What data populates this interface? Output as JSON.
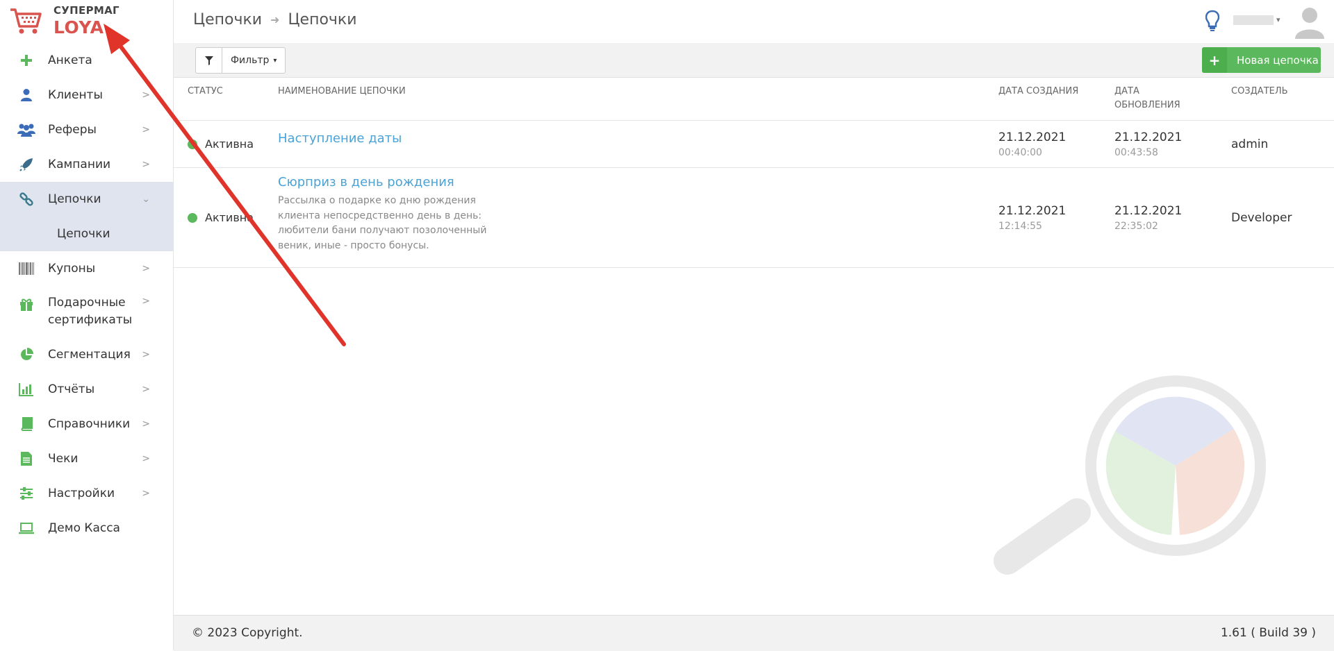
{
  "logo": {
    "line1": "СУПЕРМАГ",
    "line2": "LOYA"
  },
  "sidebar": {
    "items": [
      {
        "label": "Анкета",
        "icon": "plus-icon"
      },
      {
        "label": "Клиенты",
        "icon": "user-icon",
        "chevron": ">"
      },
      {
        "label": "Реферы",
        "icon": "users-icon",
        "chevron": ">"
      },
      {
        "label": "Кампании",
        "icon": "rocket-icon",
        "chevron": ">"
      },
      {
        "label": "Цепочки",
        "icon": "link-icon",
        "chevron": "⌄"
      },
      {
        "label": "Цепочки"
      },
      {
        "label": "Купоны",
        "icon": "barcode-icon",
        "chevron": ">"
      },
      {
        "label_line1": "Подарочные",
        "label_line2": "сертификаты",
        "icon": "gift-icon",
        "chevron": ">"
      },
      {
        "label": "Сегментация",
        "icon": "pie-chart-icon",
        "chevron": ">"
      },
      {
        "label": "Отчёты",
        "icon": "bar-chart-icon",
        "chevron": ">"
      },
      {
        "label": "Справочники",
        "icon": "book-icon",
        "chevron": ">"
      },
      {
        "label": "Чеки",
        "icon": "receipt-icon",
        "chevron": ">"
      },
      {
        "label": "Настройки",
        "icon": "sliders-icon",
        "chevron": ">"
      },
      {
        "label": "Демо Касса",
        "icon": "laptop-icon"
      }
    ]
  },
  "header": {
    "breadcrumb": [
      "Цепочки",
      "Цепочки"
    ],
    "breadcrumb_sep": "➜",
    "user_caret": "▾"
  },
  "toolbar": {
    "filter_label": "Фильтр",
    "filter_caret": "▾",
    "new_label": "Новая цепочка",
    "new_plus": "+"
  },
  "table": {
    "headers": {
      "status": "СТАТУС",
      "name": "НАИМЕНОВАНИЕ ЦЕПОЧКИ",
      "created": "ДАТА СОЗДАНИЯ",
      "updated_1": "ДАТА",
      "updated_2": "ОБНОВЛЕНИЯ",
      "creator": "СОЗДАТЕЛЬ"
    },
    "rows": [
      {
        "status": "Активна",
        "name": "Наступление даты",
        "description": "",
        "created_date": "21.12.2021",
        "created_time": "00:40:00",
        "updated_date": "21.12.2021",
        "updated_time": "00:43:58",
        "creator": "admin"
      },
      {
        "status": "Активна",
        "name": "Сюрприз в день рождения",
        "description": "Рассылка о подарке ко дню рождения клиента непосредственно день в день: любители бани получают позолоченный веник, иные - просто бонусы.",
        "created_date": "21.12.2021",
        "created_time": "12:14:55",
        "updated_date": "21.12.2021",
        "updated_time": "22:35:02",
        "creator": "Developer"
      }
    ]
  },
  "footer": {
    "copyright": "© 2023 Copyright.",
    "version": "1.61 ( Build 39 )"
  },
  "colors": {
    "accent_green": "#5cb85c",
    "link_blue": "#4aa3d6",
    "brand_red": "#d9534f",
    "active_menu_bg": "#dfe4ef",
    "annotation_arrow": "#e0342b"
  }
}
